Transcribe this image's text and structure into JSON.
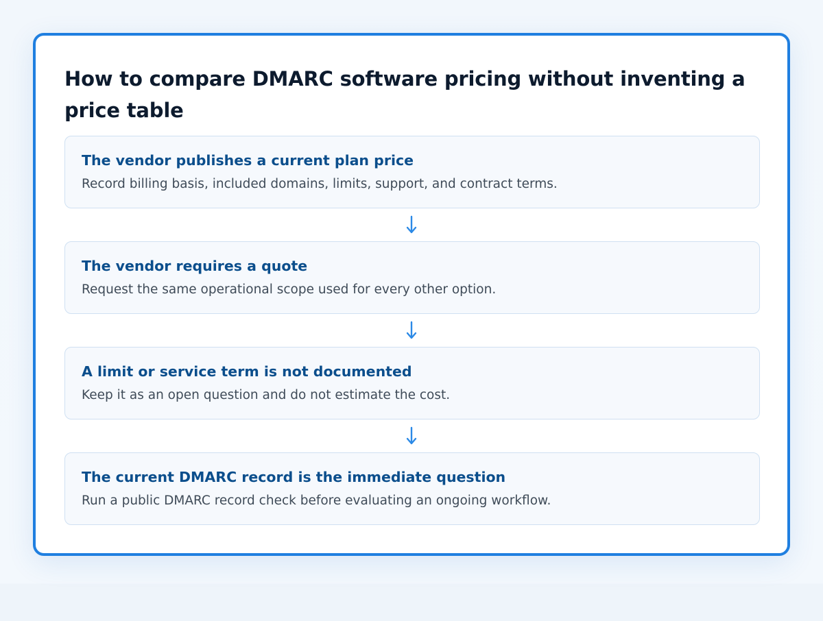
{
  "title": "How to compare DMARC software pricing without inventing a price table",
  "colors": {
    "card_border": "#1f7fe0",
    "heading": "#0b4e8c",
    "arrow": "#2b89e6",
    "step_background": "#f6f9fd"
  },
  "steps": [
    {
      "heading": "The vendor publishes a current plan price",
      "description": "Record billing basis, included domains, limits, support, and contract terms."
    },
    {
      "heading": "The vendor requires a quote",
      "description": "Request the same operational scope used for every other option."
    },
    {
      "heading": "A limit or service term is not documented",
      "description": "Keep it as an open question and do not estimate the cost."
    },
    {
      "heading": "The current DMARC record is the immediate question",
      "description": "Run a public DMARC record check before evaluating an ongoing workflow."
    }
  ],
  "connector_icon": "arrow-down-icon"
}
